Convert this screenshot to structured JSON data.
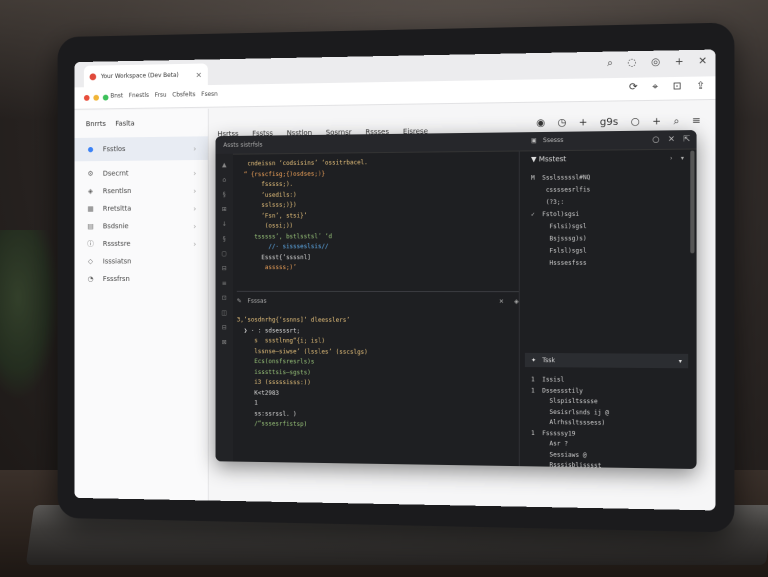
{
  "browser": {
    "tab_title": "Your Workspace (Dev Beta)",
    "tab_close": "×",
    "bookmarks": [
      "Bnst",
      "Fnestls",
      "Frsu",
      "Cbsfelts",
      "Fsesn"
    ]
  },
  "app": {
    "sidebar": {
      "header": [
        "Bnrrts",
        "Faslta"
      ],
      "items": [
        {
          "label": "Fsstlos",
          "icon": "circle-icon",
          "active": true
        },
        {
          "label": "Dsecrnt",
          "icon": "gear-icon"
        },
        {
          "label": "Rsentlsn",
          "icon": "shield-icon"
        },
        {
          "label": "Rretsltta",
          "icon": "grid-icon"
        },
        {
          "label": "Bsdsnie",
          "icon": "file-icon"
        },
        {
          "label": "Rssstsre",
          "icon": "info-icon"
        },
        {
          "label": "Isssiatsn",
          "icon": "pin-icon"
        },
        {
          "label": "Fsssfrsn",
          "icon": "bell-icon"
        }
      ]
    },
    "top_tabs": [
      "Hsrtss",
      "Fsstss",
      "Nsstlon",
      "Sosrnsr",
      "Rssses",
      "Eisrese"
    ],
    "editor": {
      "header": "Assts sistrfsls",
      "code_lines": [
        {
          "t": "   cndeissn ‘codsisins’ ‘ossitrbacel.",
          "c": "c-yel"
        },
        {
          "t": "  “ {rsscfisg;{)osdses;)}",
          "c": "c-org"
        },
        {
          "t": "       fsssss;).",
          "c": "c-yel"
        },
        {
          "t": "       ‘usedils:)",
          "c": "c-yel"
        },
        {
          "t": "       sslsss;)})",
          "c": "c-yel"
        },
        {
          "t": "       ‘Fsn’, stsi}’",
          "c": "c-yel"
        },
        {
          "t": "        (ossi;))",
          "c": "c-yel"
        },
        {
          "t": "     tsssss’, bstlsstsl’ ‘d",
          "c": "c-grn"
        },
        {
          "t": "         //· sissseslsis//",
          "c": "c-blu"
        },
        {
          "t": "       Essst{‘ssssnl]",
          "c": "c-wht"
        },
        {
          "t": "        asssss;)’",
          "c": "c-org"
        }
      ],
      "panel_title": "Fsssas",
      "code2_lines": [
        {
          "t": "3,‘sosdnrhg{‘ssnns]‘ dleesslers’",
          "c": "c-yel"
        },
        {
          "t": "",
          "c": "c-wht"
        },
        {
          "t": "  ❯ · : sdsesssrt;",
          "c": "c-wht"
        },
        {
          "t": "     s  ssstlnng“{i; isl)",
          "c": "c-yel"
        },
        {
          "t": "     lssnse—siwse’ (lssles’ (sscslgs)",
          "c": "c-yel"
        },
        {
          "t": "     Ecs(onsfsresrls)s",
          "c": "c-grn"
        },
        {
          "t": "     isssttsis—sgsts)",
          "c": "c-grn"
        },
        {
          "t": "     i3 (sssssisss:))",
          "c": "c-yel"
        },
        {
          "t": "",
          "c": "c-wht"
        },
        {
          "t": "     K<t2983",
          "c": "c-wht"
        },
        {
          "t": "     1",
          "c": "c-wht"
        },
        {
          "t": "     ss:ssrssl. )",
          "c": "c-wht"
        },
        {
          "t": "     /“sssesrfistsp)",
          "c": "c-grn"
        }
      ]
    },
    "right_panel": {
      "header": "Ssesss",
      "sub_title": "Msstest",
      "list": [
        "M  Ssslsssssl#NQ",
        "    cssssesrlfis",
        "    (?3;:",
        "✓  Fstol)sgsi",
        "     Fslsi)sgsl",
        "     Bsjsssg)s)",
        "     Fslsl)sgsl",
        "     Hsssesfsss"
      ],
      "tree_title": "Tssk",
      "tree": [
        "1  Issisl",
        "1  Dssessstily",
        "     Slspisltsssse",
        "     Sesisrlsnds ij @",
        "     Alrhssltsssess)",
        "1  Fsssssy19",
        "     Asr ?",
        "     Sessiaws @",
        "     Rsssisblisssst"
      ]
    }
  }
}
